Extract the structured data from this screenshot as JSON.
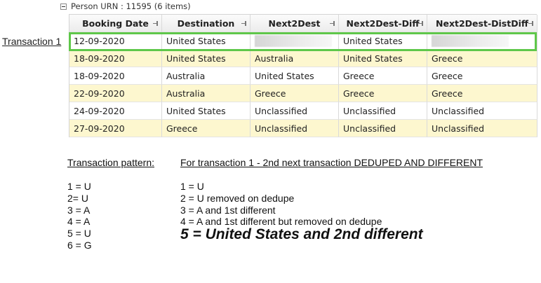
{
  "group_header": "Person URN : 11595 (6 items)",
  "transaction_link": "Transaction 1",
  "grid": {
    "columns": [
      "Booking Date",
      "Destination",
      "Next2Dest",
      "Next2Dest-Diff",
      "Next2Dest-DistDiff"
    ],
    "rows": [
      [
        "12-09-2020",
        "United States",
        "",
        "United States",
        ""
      ],
      [
        "18-09-2020",
        "United States",
        "Australia",
        "United States",
        "Greece"
      ],
      [
        "18-09-2020",
        "Australia",
        "United States",
        "Greece",
        "Greece"
      ],
      [
        "22-09-2020",
        "Australia",
        "Greece",
        "Greece",
        "Greece"
      ],
      [
        "24-09-2020",
        "United States",
        "Unclassified",
        "Unclassified",
        "Unclassified"
      ],
      [
        "27-09-2020",
        "Greece",
        "Unclassified",
        "Unclassified",
        "Unclassified"
      ]
    ]
  },
  "notes": {
    "pattern_title": "Transaction pattern:",
    "pattern_items": [
      "1 = U",
      "2=  U",
      "3 = A",
      "4 = A",
      "5 = U",
      "6 = G"
    ],
    "explanation_title": "For transaction 1 - 2nd next transaction DEDUPED AND DIFFERENT",
    "explanation_items": [
      "1 = U",
      "2 = U removed on dedupe",
      "3 = A and 1st different",
      "4 = A and 1st different but removed on dedupe"
    ],
    "explanation_emphasis": "5 = United States and 2nd different"
  },
  "colors": {
    "highlight": "#5fc74a",
    "alt_row": "#fdf7cf"
  },
  "icons": [
    "collapse-minus-icon",
    "column-pin-icon"
  ]
}
